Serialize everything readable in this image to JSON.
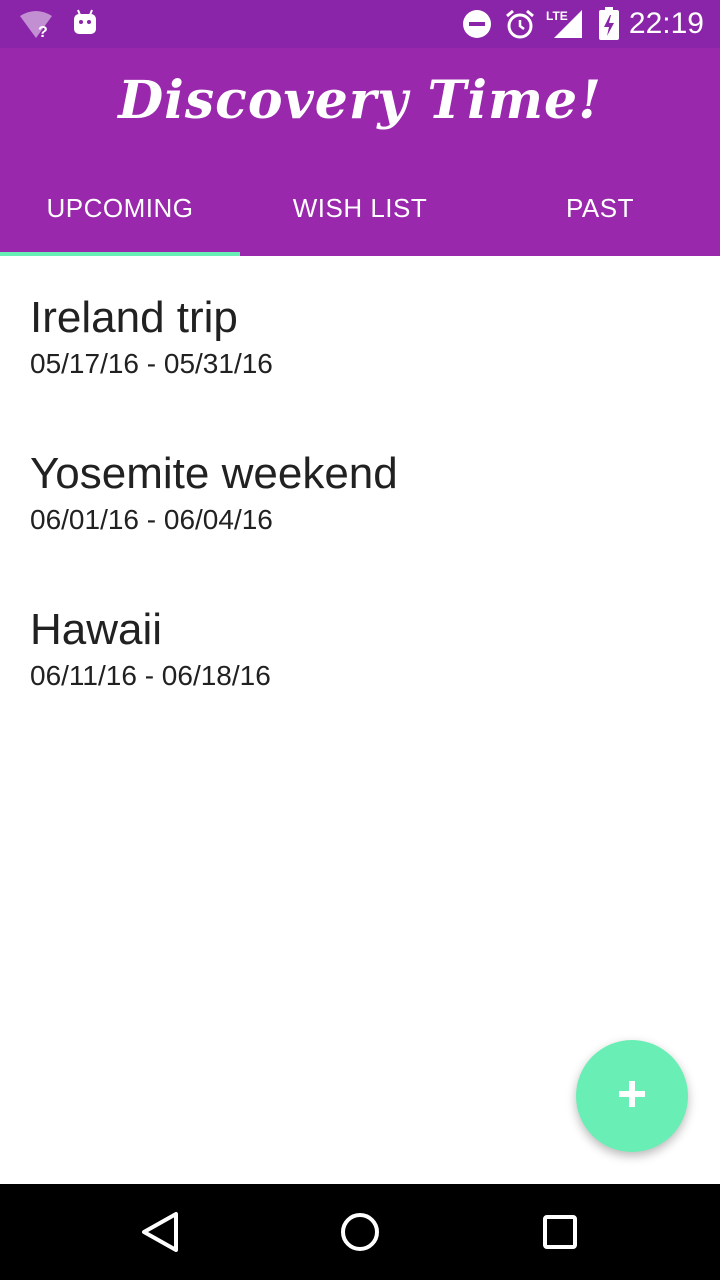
{
  "status_bar": {
    "time": "22:19",
    "network_label": "LTE",
    "icons": [
      "wifi-question-icon",
      "android-icon",
      "do-not-disturb-icon",
      "alarm-icon",
      "signal-icon",
      "battery-charging-icon"
    ]
  },
  "app_bar": {
    "title": "Discovery Time!"
  },
  "tabs": [
    {
      "label": "UPCOMING",
      "selected": true
    },
    {
      "label": "WISH LIST",
      "selected": false
    },
    {
      "label": "PAST",
      "selected": false
    }
  ],
  "trips": [
    {
      "name": "Ireland trip",
      "dates": "05/17/16 - 05/31/16"
    },
    {
      "name": "Yosemite weekend",
      "dates": "06/01/16 - 06/04/16"
    },
    {
      "name": "Hawaii",
      "dates": "06/11/16 - 06/18/16"
    }
  ],
  "fab": {
    "icon": "plus-icon"
  },
  "nav_bar": {
    "icons": [
      "back-icon",
      "home-icon",
      "recents-icon"
    ]
  },
  "colors": {
    "status_bar": "#8a24a8",
    "app_bar": "#9a28ad",
    "accent": "#69efb5",
    "text_primary": "#212121"
  }
}
